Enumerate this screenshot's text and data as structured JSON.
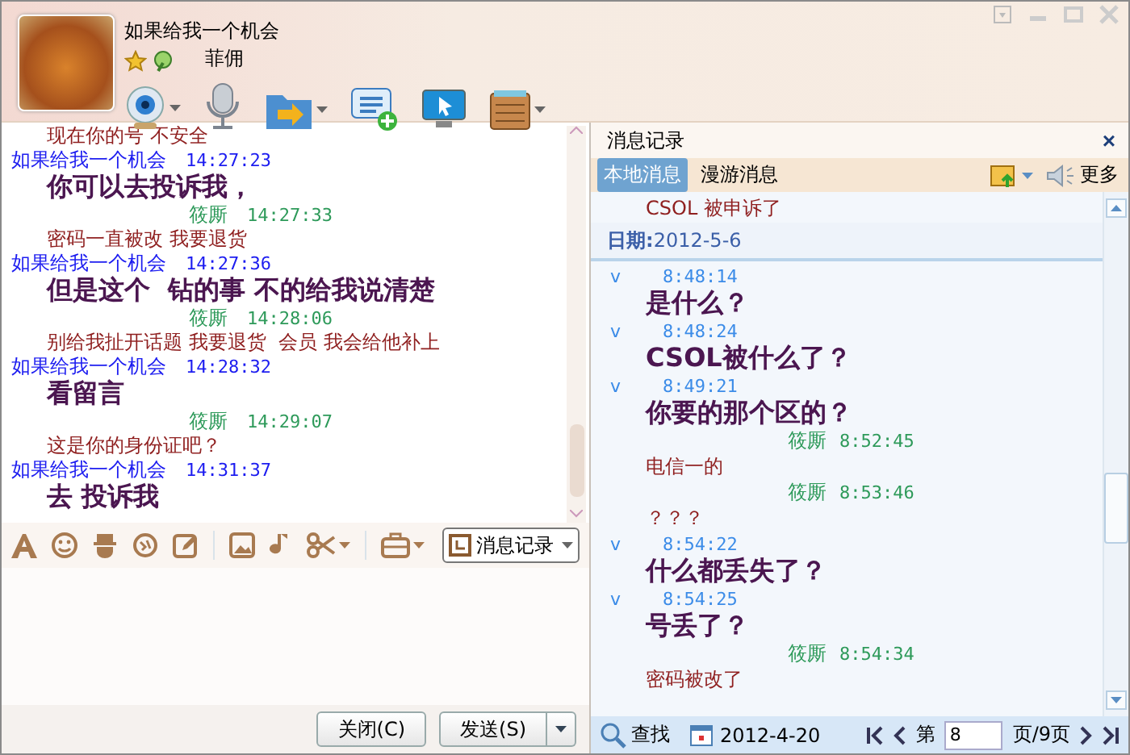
{
  "contact": {
    "name": "如果给我一个机会",
    "signature": "菲佣"
  },
  "chat": {
    "messages": [
      {
        "kind": "incoming",
        "text": "现在你的号 不安全"
      },
      {
        "kind": "outgoing",
        "name": "如果给我一个机会",
        "time": "14:27:23",
        "text": "你可以去投诉我，"
      },
      {
        "kind": "incoming",
        "name": "筱厮",
        "time": "14:27:33",
        "text": "密码一直被改 我要退货"
      },
      {
        "kind": "outgoing",
        "name": "如果给我一个机会",
        "time": "14:27:36",
        "text": "但是这个  钻的事 不的给我说清楚"
      },
      {
        "kind": "incoming",
        "name": "筱厮",
        "time": "14:28:06",
        "text": "别给我扯开话题 我要退货  会员 我会给他补上"
      },
      {
        "kind": "outgoing",
        "name": "如果给我一个机会",
        "time": "14:28:32",
        "text": "看留言"
      },
      {
        "kind": "incoming",
        "name": "筱厮",
        "time": "14:29:07",
        "text": "这是你的身份证吧？"
      },
      {
        "kind": "outgoing",
        "name": "如果给我一个机会",
        "time": "14:31:37",
        "text": "去 投诉我"
      }
    ]
  },
  "compose": {
    "history_button": "消息记录",
    "buttons": [
      "关闭(C)",
      "发送(S)"
    ]
  },
  "history": {
    "title": "消息记录",
    "close": "×",
    "tabs": [
      {
        "label": "本地消息",
        "selected": true
      },
      {
        "label": "漫游消息",
        "selected": false
      }
    ],
    "more": "更多",
    "entries": [
      {
        "kind": "incoming",
        "text": "CSOL 被申诉了"
      },
      {
        "kind": "date",
        "text": "**日期:**2012-5-6"
      },
      {
        "kind": "outgoing",
        "marker": "v",
        "time": "8:48:14",
        "text": "是什么？"
      },
      {
        "kind": "outgoing",
        "marker": "v",
        "time": "8:48:24",
        "text": "CSOL被什么了？"
      },
      {
        "kind": "outgoing",
        "marker": "v",
        "time": "8:49:21",
        "text": "你要的那个区的？"
      },
      {
        "kind": "incoming",
        "name": "筱厮",
        "time": "8:52:45",
        "text": "电信一的"
      },
      {
        "kind": "incoming",
        "name": "筱厮",
        "time": "8:53:46",
        "text": "？？？"
      },
      {
        "kind": "outgoing",
        "marker": "v",
        "time": "8:54:22",
        "text": "什么都丢失了？"
      },
      {
        "kind": "outgoing",
        "marker": "v",
        "time": "8:54:25",
        "text": "号丢了？"
      },
      {
        "kind": "incoming",
        "name": "筱厮",
        "time": "8:54:34",
        "text": "密码被改了"
      }
    ],
    "footer": {
      "search": "查找",
      "date": "2012-4-20",
      "page_prefix": "第",
      "page": "8",
      "page_suffix": "页/9页"
    }
  }
}
